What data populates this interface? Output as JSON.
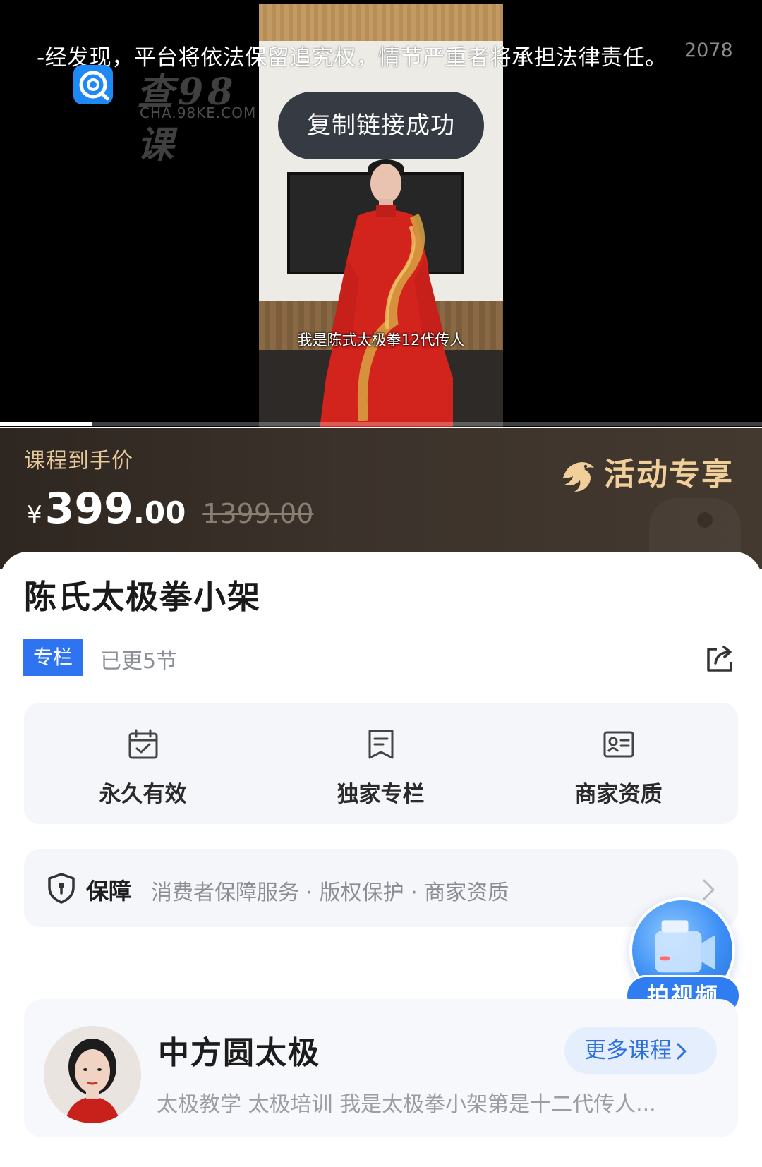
{
  "video": {
    "warning_text": "-经发现，平台将依法保留追究权，情节严重者将承担法律责任。",
    "overlay_code": "2078",
    "subtitle": "我是陈式太极拳12代传人",
    "toast": "复制链接成功",
    "progress": 0.12,
    "watermark": {
      "icon": "chat-bubble-icon",
      "name": "查98课",
      "domain": "CHA.98KE.COM"
    }
  },
  "price": {
    "label": "课程到手价",
    "currency": "¥",
    "integer": "399",
    "decimal": ".00",
    "original": "1399.00",
    "promo_label": "活动专享",
    "promo_icon": "bird-icon"
  },
  "course": {
    "title": "陈氏太极拳小架",
    "tag": "专栏",
    "updated": "已更5节",
    "share_icon": "share-icon"
  },
  "features": [
    {
      "icon": "calendar-check-icon",
      "label": "永久有效"
    },
    {
      "icon": "document-icon",
      "label": "独家专栏"
    },
    {
      "icon": "id-card-icon",
      "label": "商家资质"
    }
  ],
  "guarantee": {
    "title": "保障",
    "description": "消费者保障服务 · 版权保护 · 商家资质",
    "icon": "shield-icon"
  },
  "fab": {
    "label": "拍视频",
    "icon": "camera-icon"
  },
  "author": {
    "name": "中方圆太极",
    "description": "太极教学 太极培训 我是太极拳小架第是十二代传人...",
    "more_label": "更多课程",
    "more_icon": "chevron-right-icon"
  },
  "colors": {
    "accent": "#2e74f0",
    "banner_gold": "#e8c89a",
    "banner_bg": "#3b322b"
  }
}
